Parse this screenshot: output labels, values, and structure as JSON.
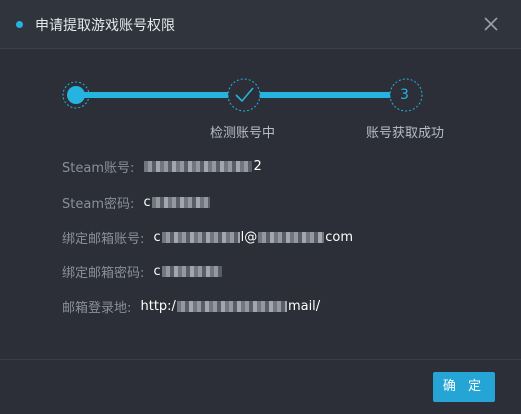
{
  "dialog": {
    "title": "申请提取游戏账号权限",
    "accent_color": "#25b3e0",
    "confirm_label": "确 定"
  },
  "stepper": {
    "steps": [
      {
        "label": "",
        "status": "active"
      },
      {
        "label": "检测账号中",
        "status": "done"
      },
      {
        "label": "账号获取成功",
        "number": "3",
        "status": "pending"
      }
    ]
  },
  "fields": [
    {
      "label": "Steam账号:",
      "value_prefix": "",
      "value_suffix": "2"
    },
    {
      "label": "Steam密码:",
      "value_prefix": "c",
      "value_suffix": ""
    },
    {
      "label": "绑定邮箱账号:",
      "value_prefix": "c",
      "value_mid": "l@",
      "value_suffix": "com"
    },
    {
      "label": "绑定邮箱密码:",
      "value_prefix": "c",
      "value_suffix": ""
    },
    {
      "label": "邮箱登录地:",
      "value_prefix": "http:/",
      "value_suffix": "mail/"
    }
  ]
}
